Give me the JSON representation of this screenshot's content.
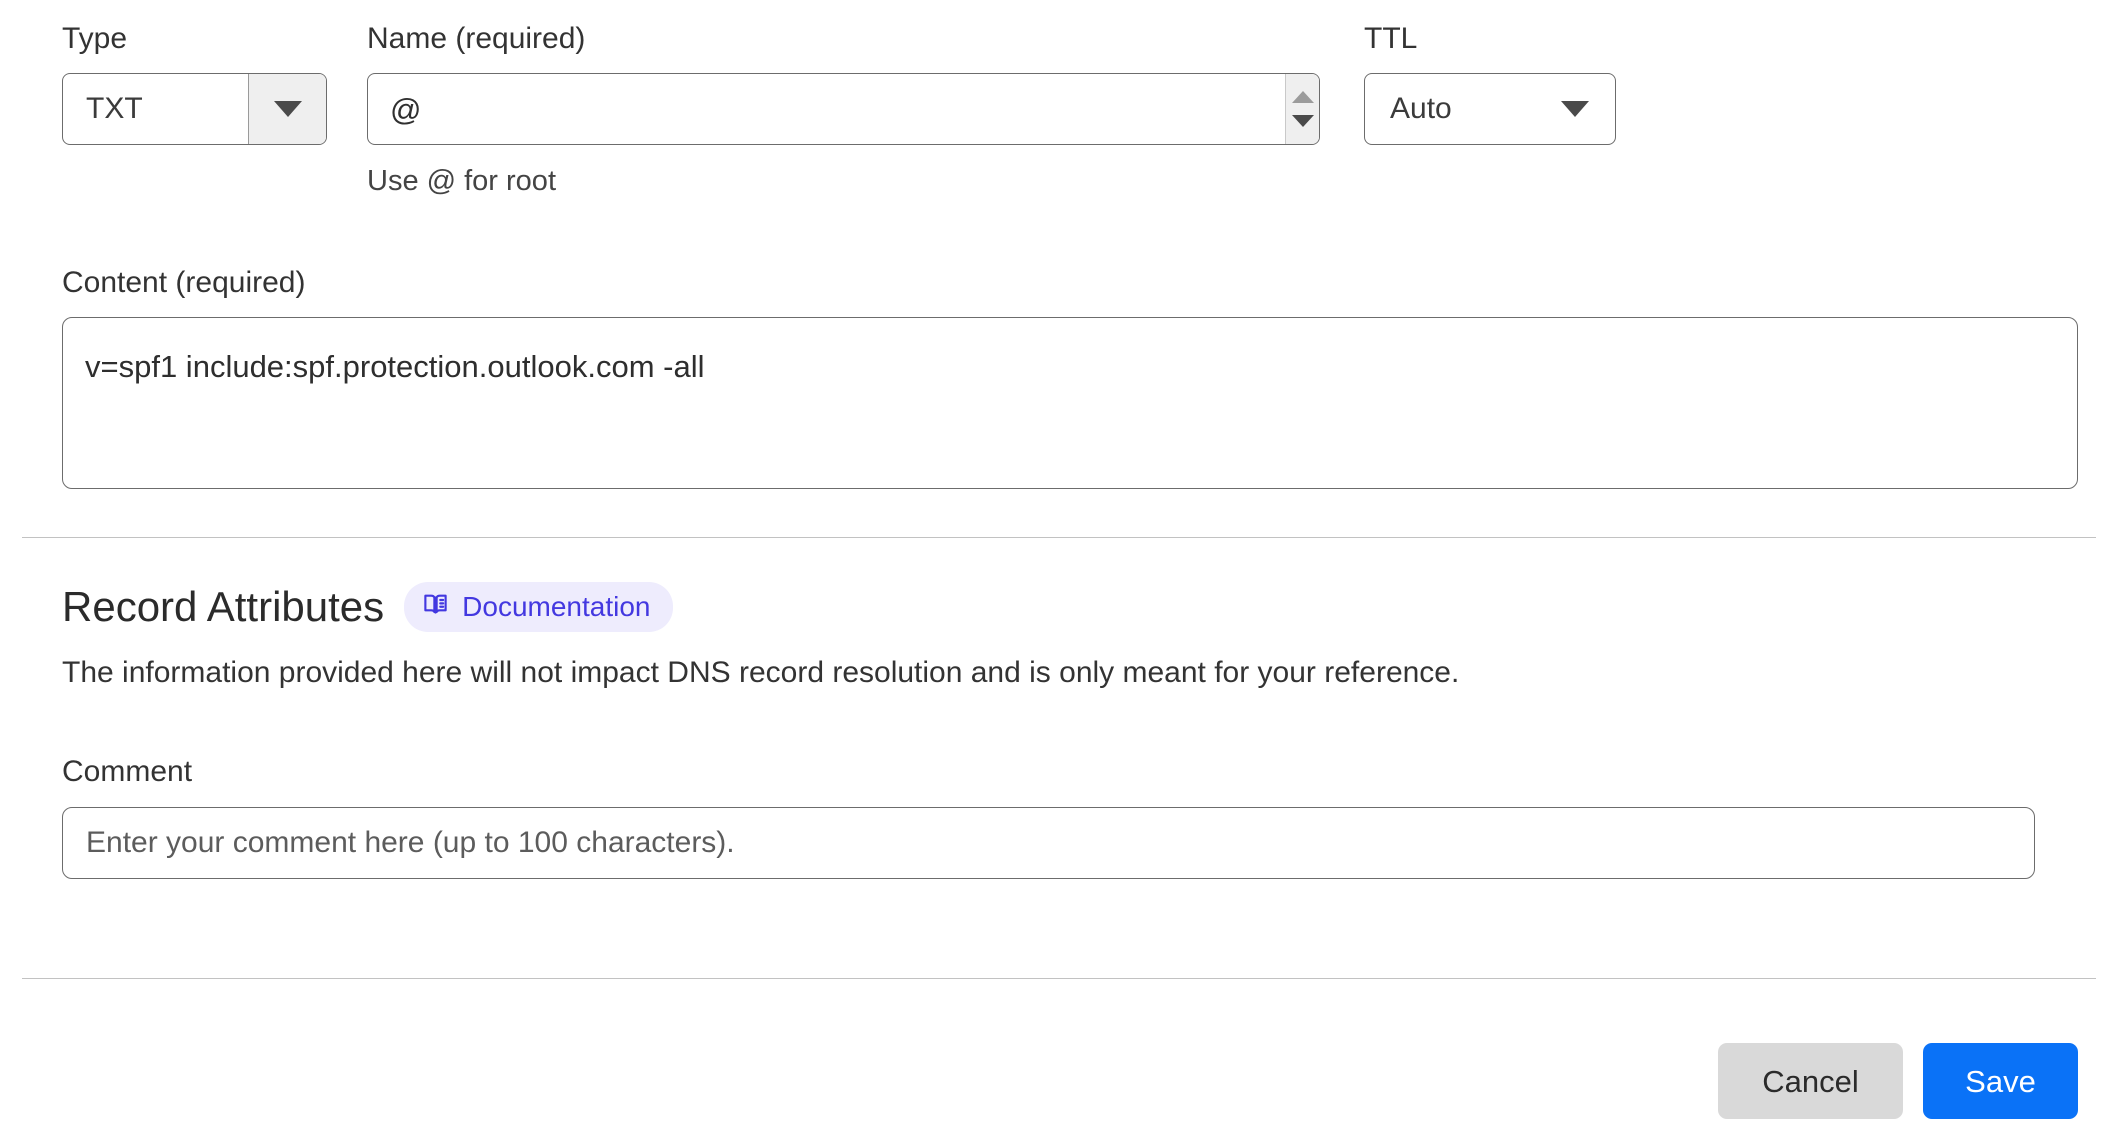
{
  "form": {
    "type": {
      "label": "Type",
      "value": "TXT",
      "icon": "chevron-down-icon"
    },
    "name": {
      "label": "Name (required)",
      "value": "@",
      "help": "Use @ for root",
      "spinner_up_icon": "spinner-up-icon",
      "spinner_down_icon": "spinner-down-icon"
    },
    "ttl": {
      "label": "TTL",
      "value": "Auto",
      "icon": "chevron-down-icon"
    },
    "content": {
      "label": "Content (required)",
      "value": "v=spf1 include:spf.protection.outlook.com -all"
    }
  },
  "record_attributes": {
    "title": "Record Attributes",
    "documentation_badge": {
      "label": "Documentation",
      "icon": "book-icon",
      "text_color": "#4338e0",
      "background_color": "#eeecfd"
    },
    "description": "The information provided here will not impact DNS record resolution and is only meant for your reference.",
    "comment": {
      "label": "Comment",
      "value": "",
      "placeholder": "Enter your comment here (up to 100 characters)."
    }
  },
  "footer": {
    "cancel_label": "Cancel",
    "save_label": "Save",
    "save_color": "#0a72f7",
    "cancel_color": "#d9d9d9"
  }
}
